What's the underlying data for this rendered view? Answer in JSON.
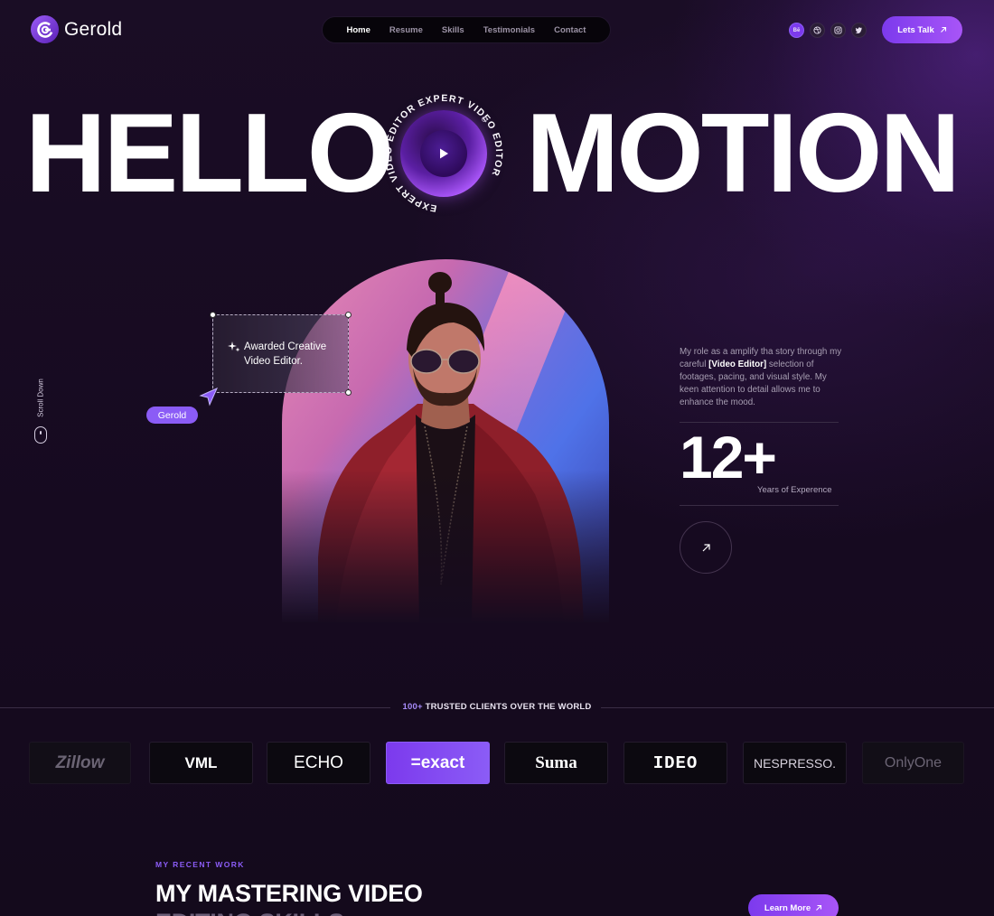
{
  "header": {
    "brand": "Gerold",
    "nav": [
      {
        "label": "Home",
        "active": true
      },
      {
        "label": "Resume",
        "active": false
      },
      {
        "label": "Skills",
        "active": false
      },
      {
        "label": "Testimonials",
        "active": false
      },
      {
        "label": "Contact",
        "active": false
      }
    ],
    "socials": [
      {
        "icon": "behance-icon",
        "glyph": "Bē"
      },
      {
        "icon": "dribbble-icon",
        "glyph": "◎"
      },
      {
        "icon": "instagram-icon",
        "glyph": "▢"
      },
      {
        "icon": "twitter-icon",
        "glyph": "✦"
      }
    ],
    "cta_label": "Lets Talk"
  },
  "hero": {
    "word_left": "HELLO",
    "word_right": "MOTION",
    "orb_ring_text": "EXPERT VIDEO EDITOR EXPERT VIDEO EDITOR"
  },
  "callout": {
    "line1": "Awarded Creative",
    "line2": "Video Editor.",
    "tag": "Gerold"
  },
  "scroll_label": "Scroll Down",
  "about": {
    "text_before": "My role as a  amplify tha story through my careful ",
    "highlight": "[Video Editor]",
    "text_after": " selection of footages, pacing, and visual style. My keen attention to detail allows me to enhance the mood.",
    "stat_value": "12+",
    "stat_label": "Years of Experence"
  },
  "trusted": {
    "count": "100+",
    "title": "TRUSTED CLIENTS OVER THE WORLD",
    "logos": [
      "Zillow",
      "VML",
      "ECHO",
      "=exact",
      "Suma",
      "IDEO",
      "NESPRESSO.",
      "OnlyOne"
    ]
  },
  "recent": {
    "label": "MY RECENT WORK",
    "title_line1": "MY MASTERING VIDEO",
    "title_line2": "EDITING SKILLS",
    "cta_label": "Learn More"
  },
  "colors": {
    "accent": "#8b5cf6",
    "background": "#150b1d"
  }
}
